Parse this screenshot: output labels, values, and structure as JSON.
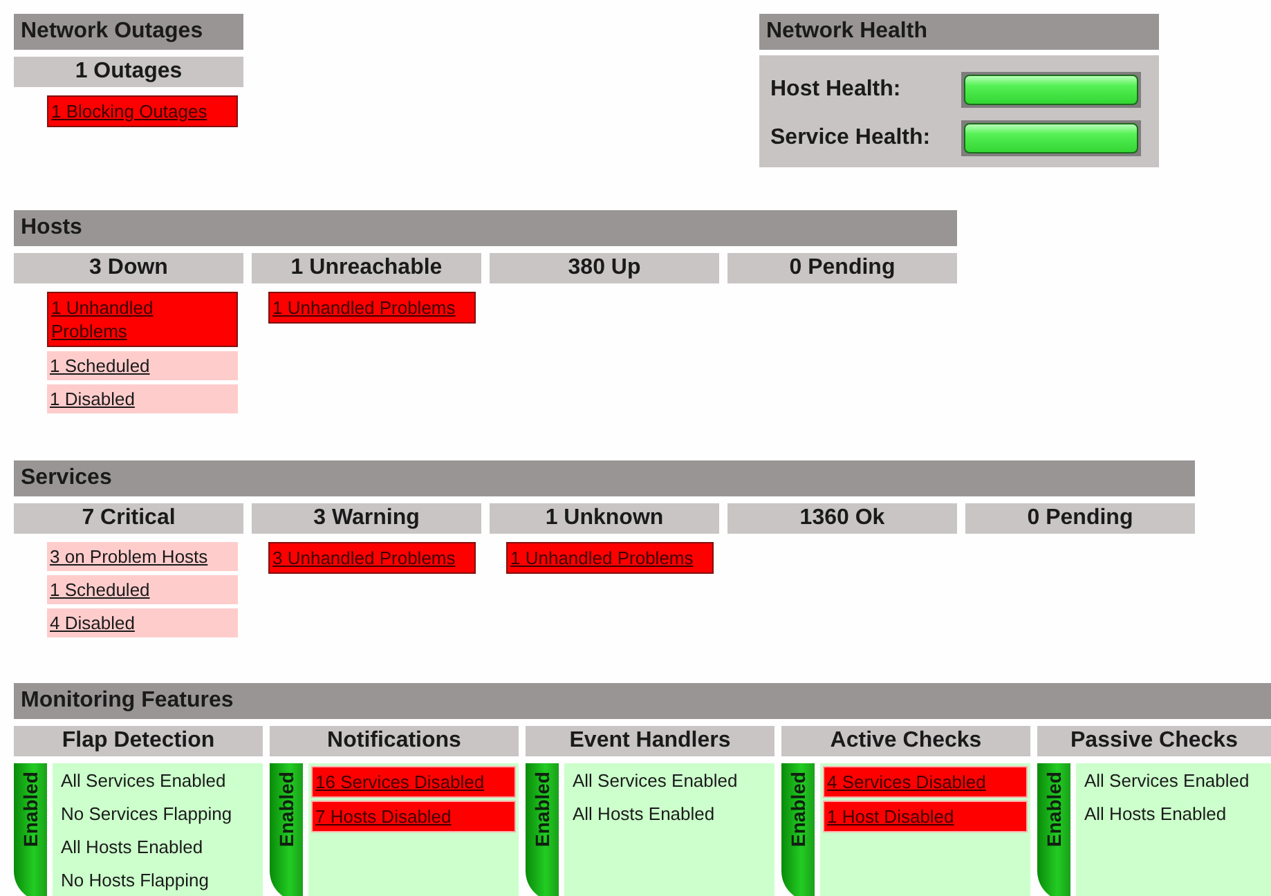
{
  "network_outages": {
    "title": "Network Outages",
    "summary": "1 Outages",
    "items": [
      {
        "kind": "problem",
        "text": "1 Blocking Outages"
      }
    ]
  },
  "network_health": {
    "title": "Network Health",
    "meters": [
      {
        "label": "Host Health:",
        "level": 1
      },
      {
        "label": "Service Health:",
        "level": 1
      }
    ]
  },
  "hosts": {
    "title": "Hosts",
    "columns": [
      {
        "heading": "3 Down",
        "items": [
          {
            "kind": "problem",
            "text": "1 Unhandled Problems"
          },
          {
            "kind": "note",
            "text": "1 Scheduled"
          },
          {
            "kind": "note",
            "text": "1 Disabled"
          }
        ]
      },
      {
        "heading": "1 Unreachable",
        "items": [
          {
            "kind": "problem",
            "text": "1 Unhandled Problems"
          }
        ]
      },
      {
        "heading": "380 Up"
      },
      {
        "heading": "0 Pending"
      }
    ]
  },
  "services": {
    "title": "Services",
    "columns": [
      {
        "heading": "7 Critical",
        "items": [
          {
            "kind": "note",
            "text": "3 on Problem Hosts"
          },
          {
            "kind": "note",
            "text": "1 Scheduled"
          },
          {
            "kind": "note",
            "text": "4 Disabled"
          }
        ]
      },
      {
        "heading": "3 Warning",
        "items": [
          {
            "kind": "problem",
            "text": "3 Unhandled Problems"
          }
        ]
      },
      {
        "heading": "1 Unknown",
        "items": [
          {
            "kind": "problem",
            "text": "1 Unhandled Problems"
          }
        ]
      },
      {
        "heading": "1360 Ok"
      },
      {
        "heading": "0 Pending"
      }
    ]
  },
  "monitoring_features": {
    "title": "Monitoring Features",
    "features": [
      {
        "heading": "Flap Detection",
        "status": "Enabled",
        "enabled": true,
        "items": [
          {
            "kind": "text",
            "text": "All Services Enabled"
          },
          {
            "kind": "text",
            "text": "No Services Flapping"
          },
          {
            "kind": "text",
            "text": "All Hosts Enabled"
          },
          {
            "kind": "text",
            "text": "No Hosts Flapping"
          }
        ]
      },
      {
        "heading": "Notifications",
        "status": "Enabled",
        "enabled": true,
        "items": [
          {
            "kind": "problem",
            "text": "16 Services Disabled"
          },
          {
            "kind": "problem",
            "text": "7 Hosts Disabled"
          }
        ]
      },
      {
        "heading": "Event Handlers",
        "status": "Enabled",
        "enabled": true,
        "items": [
          {
            "kind": "text",
            "text": "All Services Enabled"
          },
          {
            "kind": "text",
            "text": "All Hosts Enabled"
          }
        ]
      },
      {
        "heading": "Active Checks",
        "status": "Enabled",
        "enabled": true,
        "items": [
          {
            "kind": "problem",
            "text": "4 Services Disabled"
          },
          {
            "kind": "problem",
            "text": "1 Host Disabled"
          }
        ]
      },
      {
        "heading": "Passive Checks",
        "status": "Enabled",
        "enabled": true,
        "items": [
          {
            "kind": "text",
            "text": "All Services Enabled"
          },
          {
            "kind": "text",
            "text": "All Hosts Enabled"
          }
        ]
      }
    ]
  }
}
